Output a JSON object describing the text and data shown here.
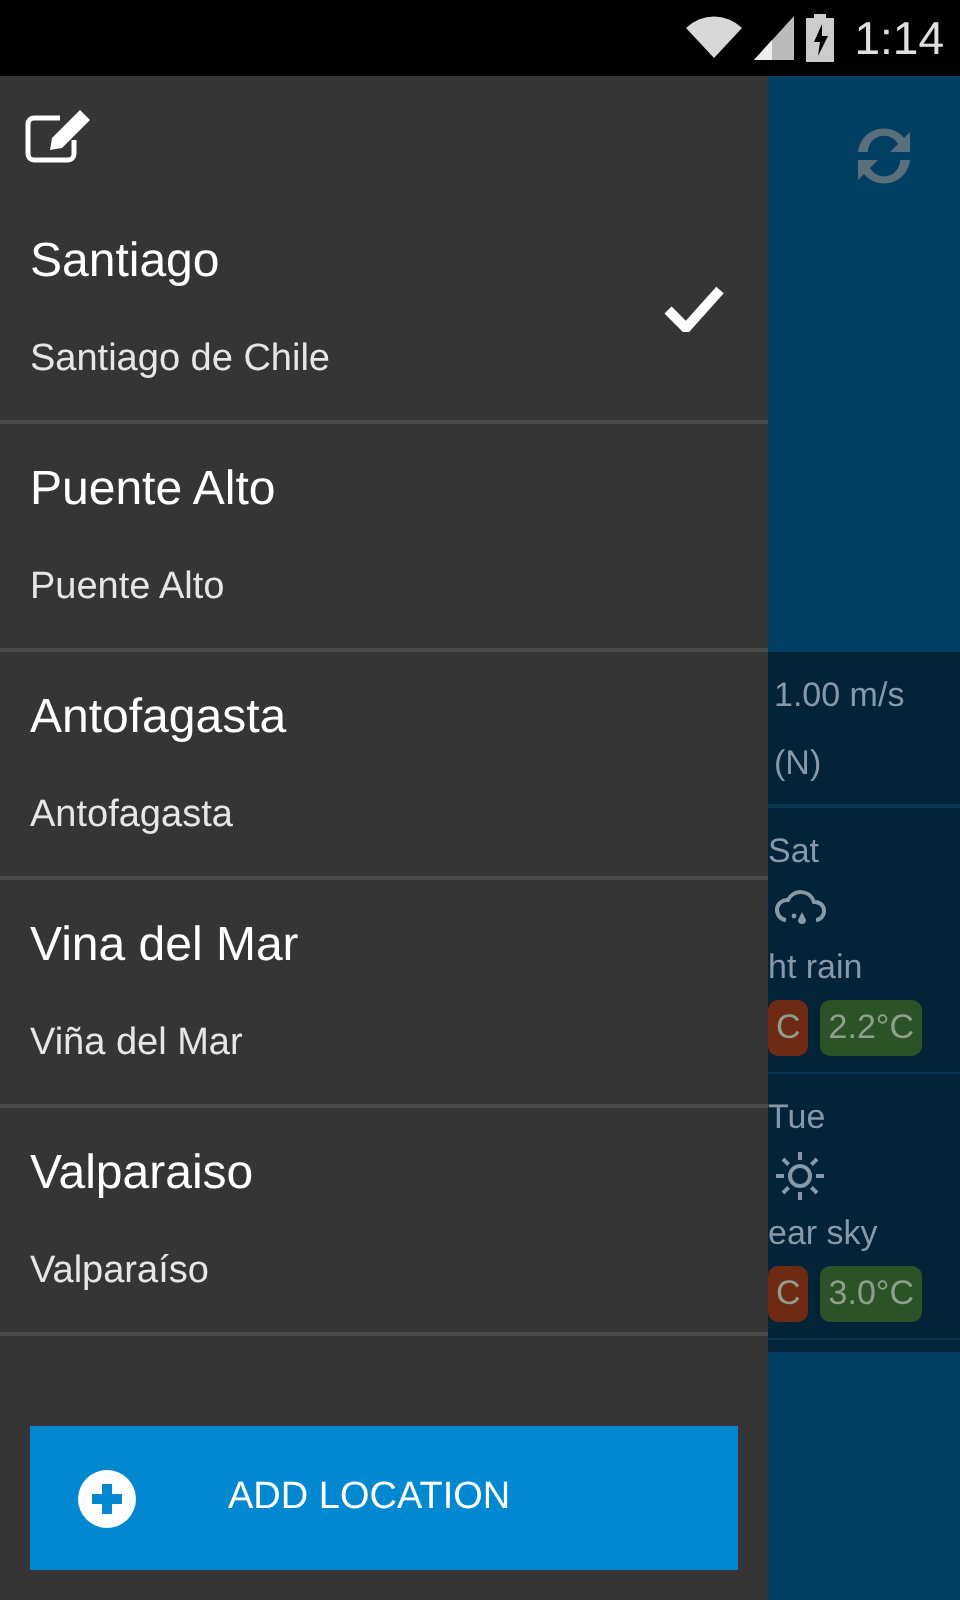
{
  "status_bar": {
    "time": "1:14"
  },
  "drawer": {
    "locations": [
      {
        "name": "Santiago",
        "subtitle": "Santiago de Chile",
        "selected": true
      },
      {
        "name": "Puente Alto",
        "subtitle": "Puente Alto",
        "selected": false
      },
      {
        "name": "Antofagasta",
        "subtitle": "Antofagasta",
        "selected": false
      },
      {
        "name": "Vina del Mar",
        "subtitle": "Viña del Mar",
        "selected": false
      },
      {
        "name": "Valparaiso",
        "subtitle": "Valparaíso",
        "selected": false
      }
    ],
    "add_button": "ADD LOCATION"
  },
  "weather": {
    "wind": "1.00 m/s",
    "direction": "(N)",
    "days": [
      {
        "day": "Sat",
        "kind": "rain",
        "description": "ht rain",
        "high": "C",
        "low": "2.2°C"
      },
      {
        "day": "Tue",
        "kind": "sun",
        "description": "ear sky",
        "high": "C",
        "low": "3.0°C"
      }
    ]
  }
}
